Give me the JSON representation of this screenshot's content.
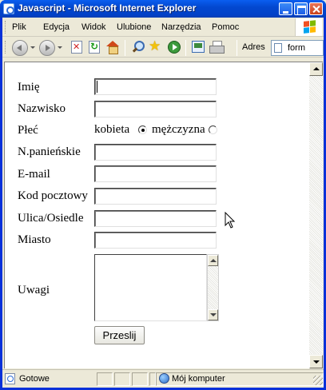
{
  "window": {
    "title": "Javascript - Microsoft Internet Explorer"
  },
  "menu": {
    "items": [
      "Plik",
      "Edycja",
      "Widok",
      "Ulubione",
      "Narzędzia",
      "Pomoc"
    ]
  },
  "toolbar": {
    "address_label": "Adres",
    "address_value": "form",
    "icons": [
      "back-icon",
      "forward-icon",
      "stop-icon",
      "refresh-icon",
      "home-icon",
      "search-icon",
      "favorites-icon",
      "media-icon",
      "mail-icon",
      "print-icon"
    ]
  },
  "form": {
    "labels": {
      "imie": "Imię",
      "nazwisko": "Nazwisko",
      "plec": "Płeć",
      "panienskie": "N.panieńskie",
      "email": "E-mail",
      "kod": "Kod pocztowy",
      "ulica": "Ulica/Osiedle",
      "miasto": "Miasto",
      "uwagi": "Uwagi"
    },
    "gender": {
      "female": "kobieta",
      "male": "mężczyzna",
      "selected": "kobieta"
    },
    "values": {
      "imie": "",
      "nazwisko": "",
      "panienskie": "",
      "email": "",
      "kod": "",
      "ulica": "",
      "miasto": "",
      "uwagi": ""
    },
    "submit_label": "Przeslij"
  },
  "status": {
    "text": "Gotowe",
    "zone": "Mój komputer"
  }
}
